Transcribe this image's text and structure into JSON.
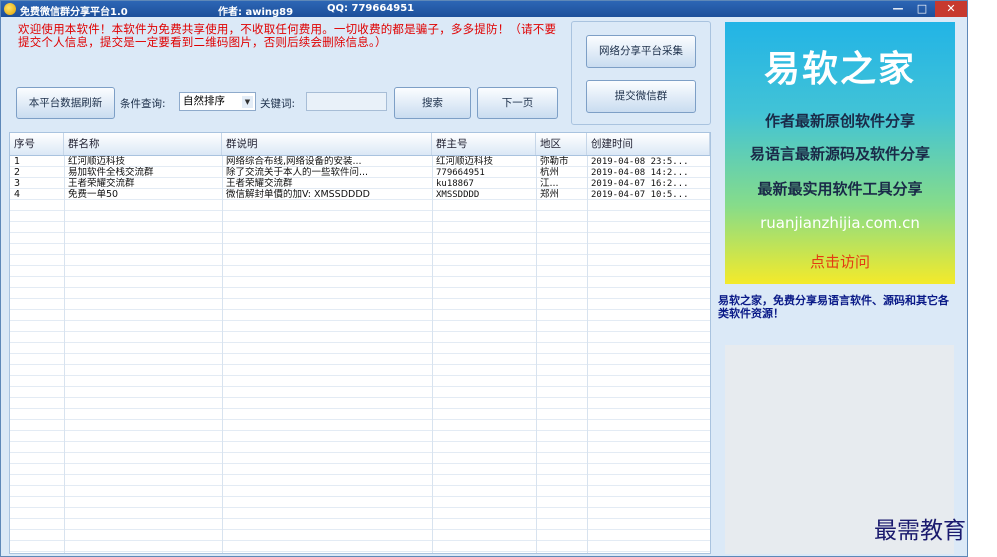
{
  "titlebar": {
    "title": "免费微信群分享平台1.0",
    "author": "作者: awing89",
    "qq": "QQ: 779664951",
    "minimize": "—",
    "maximize": "□",
    "close": "✕"
  },
  "notice": "欢迎使用本软件！本软件为免费共享使用，不收取任何费用。一切收费的都是骗子，多多提防！（请不要提交个人信息，提交是一定要看到二维码图片，否则后续会删除信息。）",
  "toolbar": {
    "refresh_label": "本平台数据刷新",
    "condition_label": "条件查询:",
    "sort_value": "自然排序",
    "keyword_label": "关键词:",
    "keyword_value": "",
    "search_label": "搜索",
    "next_label": "下一页",
    "collect_label": "网络分享平台采集",
    "submit_label": "提交微信群"
  },
  "table": {
    "headers": [
      "序号",
      "群名称",
      "群说明",
      "群主号",
      "地区",
      "创建时间"
    ],
    "rows": [
      [
        "1",
        "红河顺迈科技",
        "网络综合布线,网络设备的安装...",
        "红河顺迈科技",
        "弥勒市",
        "2019-04-08 23:5..."
      ],
      [
        "2",
        "易加软件全栈交流群",
        "除了交流关于本人的一些软件问...",
        "779664951",
        "杭州",
        "2019-04-08 14:2..."
      ],
      [
        "3",
        "王者荣耀交流群",
        "王者荣耀交流群",
        "ku18867",
        "江...",
        "2019-04-07 16:2..."
      ],
      [
        "4",
        "免费一单50",
        "微信解封单價的加V: XMSSDDDD",
        "XMSSDDDD",
        "郑州",
        "2019-04-07 10:5..."
      ]
    ]
  },
  "ad": {
    "title": "易软之家",
    "line1": "作者最新原创软件分享",
    "line2": "易语言最新源码及软件分享",
    "line3": "最新最实用软件工具分享",
    "url": "ruanjianzhijia.com.cn",
    "visit": "点击访问",
    "description": "易软之家，免费分享易语言软件、源码和其它各类软件资源！"
  },
  "watermark": "最需教育"
}
